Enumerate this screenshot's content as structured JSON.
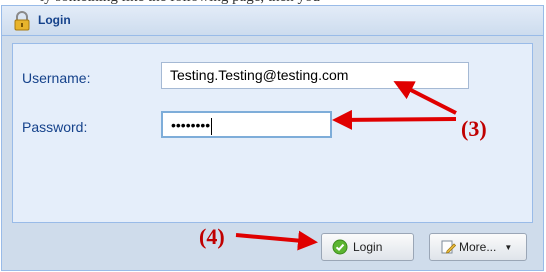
{
  "window": {
    "title": "Login"
  },
  "form": {
    "username_label": "Username:",
    "username_value": "Testing.Testing@testing.com",
    "password_label": "Password:",
    "password_mask": "••••••••"
  },
  "buttons": {
    "login_label": "Login",
    "more_label": "More...",
    "more_arrow": "▼"
  },
  "annotations": {
    "step3": "(3)",
    "step4": "(4)"
  },
  "colors": {
    "accent": "#15428b",
    "annotation": "#c00000"
  }
}
